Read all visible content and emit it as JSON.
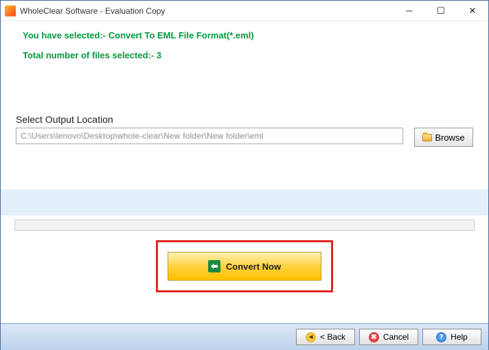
{
  "window": {
    "title": "WholeClear Software - Evaluation Copy"
  },
  "status": {
    "format_line": "You have selected:- Convert To EML File Format(*.eml)",
    "count_line": "Total number of files selected:- 3"
  },
  "output": {
    "label": "Select Output Location",
    "path": "C:\\Users\\lenovo\\Desktop\\whole-clear\\New folder\\New folder\\eml",
    "browse_label": "Browse"
  },
  "actions": {
    "convert_label": "Convert Now"
  },
  "footer": {
    "back_label": "< Back",
    "cancel_label": "Cancel",
    "help_label": "Help"
  }
}
